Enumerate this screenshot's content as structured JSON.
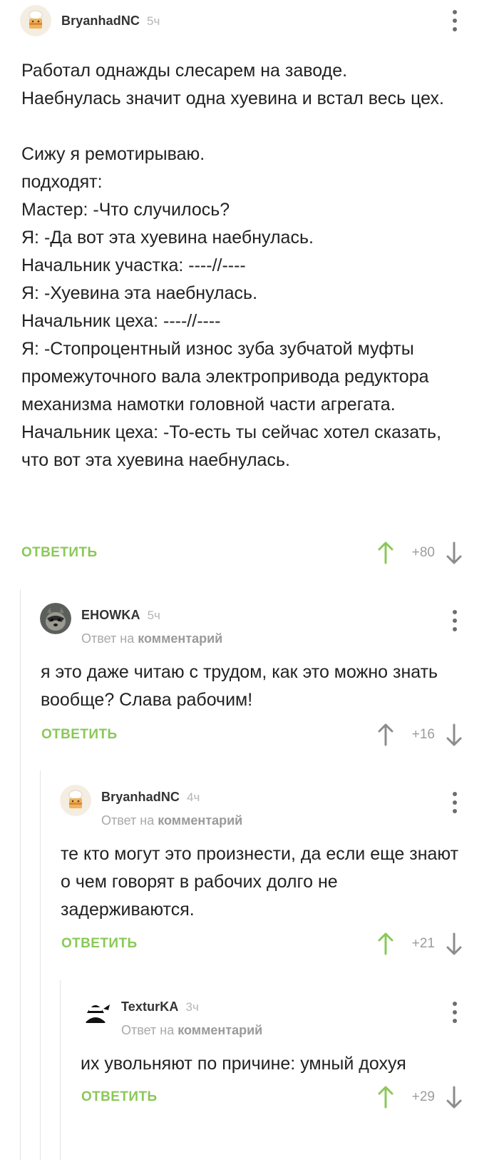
{
  "comments": [
    {
      "author": "BryanhadNC",
      "time": "5ч",
      "reply_prefix": "",
      "reply_target": "",
      "text": "Работал однажды слесарем на заводе.\nНаебнулась значит одна хуевина и встал весь цех.\n\nСижу я ремотирываю.\nподходят:\nМастер: -Что случилось?\nЯ: -Да вот эта хуевина наебнулась.\nНачальник участка: ----//----\nЯ: -Хуевина эта наебнулась.\nНачальник цеха: ----//----\nЯ: -Стопроцентный износ зуба зубчатой муфты промежуточного вала электропривода редуктора механизма намотки головной части агрегата.\nНачальник цеха: -То-есть ты сейчас хотел сказать, что вот эта хуевина наебнулась.",
      "reply_label": "ОТВЕТИТЬ",
      "score": "+80",
      "upvoted": true,
      "avatar": "chef-cake-avatar"
    },
    {
      "author": "EHOWKA",
      "time": "5ч",
      "reply_prefix": "Ответ на",
      "reply_target": "комментарий",
      "text": "я это даже читаю с трудом, как это можно знать вообще? Слава рабочим!",
      "reply_label": "ОТВЕТИТЬ",
      "score": "+16",
      "upvoted": false,
      "avatar": "raccoon-avatar"
    },
    {
      "author": "BryanhadNC",
      "time": "4ч",
      "reply_prefix": "Ответ на",
      "reply_target": "комментарий",
      "text": "те кто могут это произнести, да если еще знают о чем говорят в рабочих долго не задерживаются.",
      "reply_label": "ОТВЕТИТЬ",
      "score": "+21",
      "upvoted": true,
      "avatar": "chef-cake-avatar"
    },
    {
      "author": "TexturKA",
      "time": "3ч",
      "reply_prefix": "Ответ на",
      "reply_target": "комментарий",
      "text": "их увольняют по причине: умный дохуя",
      "reply_label": "ОТВЕТИТЬ",
      "score": "+29",
      "upvoted": true,
      "avatar": "ninja-avatar"
    }
  ],
  "colors": {
    "accent_green": "#8ac858",
    "arrow_gray": "#8c8c8c",
    "thread_line": "#e2e2e2"
  },
  "icons": [
    "more-vertical-icon",
    "arrow-up-icon",
    "arrow-down-icon"
  ]
}
